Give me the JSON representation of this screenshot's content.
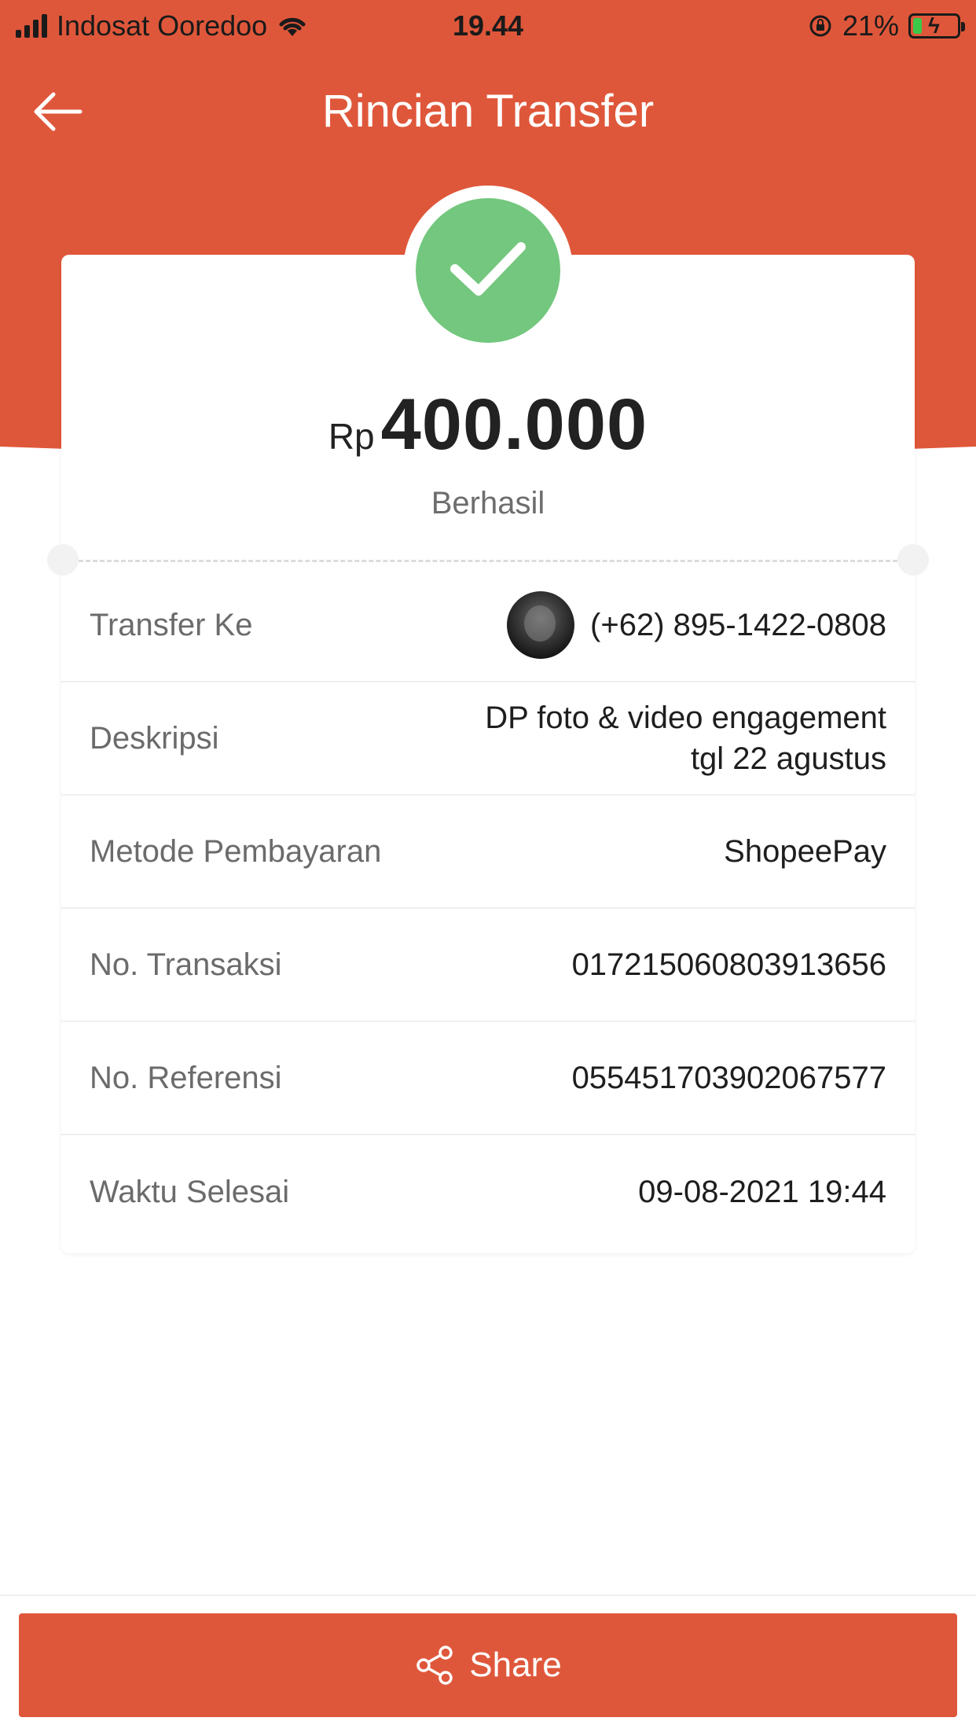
{
  "status_bar": {
    "carrier": "Indosat Ooredoo",
    "time": "19.44",
    "battery_percent": "21%",
    "battery_level": 0.21
  },
  "nav": {
    "title": "Rincian Transfer",
    "back_icon": "arrow-left-icon"
  },
  "summary": {
    "currency": "Rp",
    "amount": "400.000",
    "status": "Berhasil",
    "status_icon": "check-icon"
  },
  "details": {
    "transfer_to": {
      "label": "Transfer Ke",
      "value": "(+62) 895-1422-0808"
    },
    "description": {
      "label": "Deskripsi",
      "line1": "DP foto & video engagement",
      "line2": "tgl 22 agustus"
    },
    "payment_method": {
      "label": "Metode Pembayaran",
      "value": "ShopeePay"
    },
    "transaction_no": {
      "label": "No. Transaksi",
      "value": "017215060803913656"
    },
    "reference_no": {
      "label": "No. Referensi",
      "value": "055451703902067577"
    },
    "completed_time": {
      "label": "Waktu Selesai",
      "value": "09-08-2021 19:44"
    }
  },
  "actions": {
    "share_label": "Share",
    "share_icon": "share-icon"
  },
  "colors": {
    "brand": "#df573a",
    "success": "#73c77e"
  }
}
